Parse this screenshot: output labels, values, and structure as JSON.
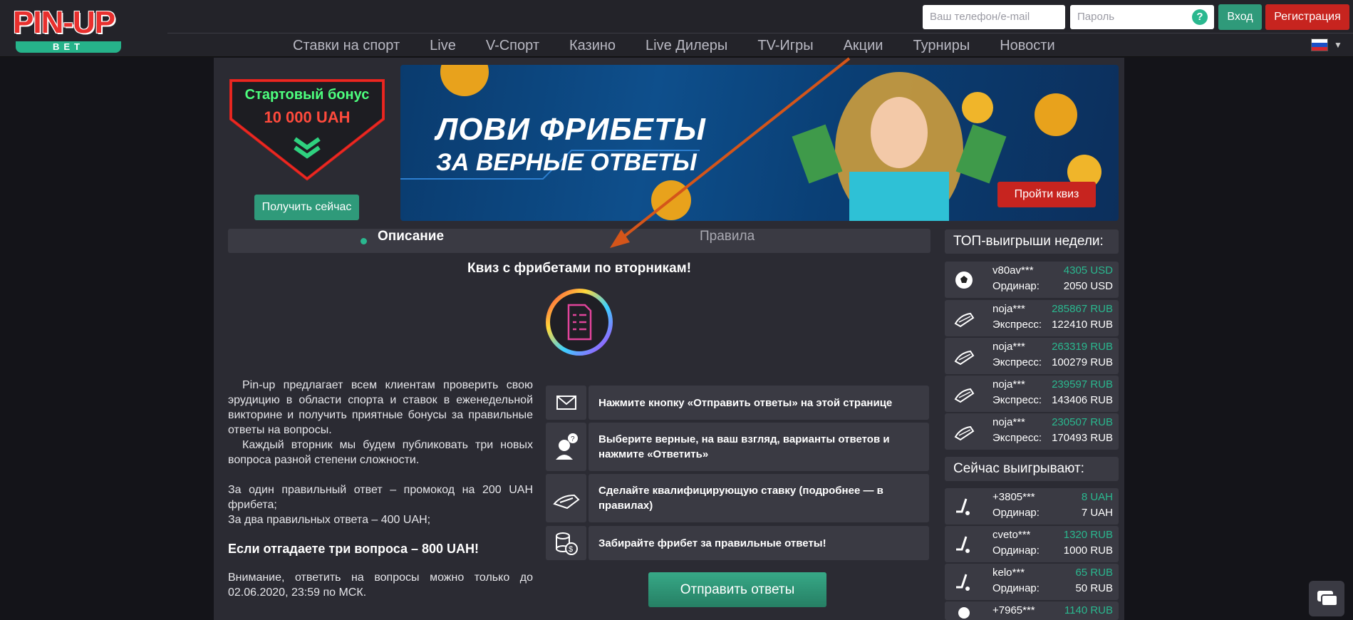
{
  "brand": {
    "logo": "PIN-UP",
    "sub": "BET"
  },
  "nav": [
    "Ставки на спорт",
    "Live",
    "V-Спорт",
    "Казино",
    "Live Дилеры",
    "TV-Игры",
    "Акции",
    "Турниры",
    "Новости"
  ],
  "auth": {
    "phone_placeholder": "Ваш телефон/e-mail",
    "password_placeholder": "Пароль",
    "help": "?",
    "login": "Вход",
    "register": "Регистрация"
  },
  "bonus": {
    "line1": "Стартовый бонус",
    "line2": "10 000 UAH",
    "button": "Получить сейчас"
  },
  "banner": {
    "title1": "ЛОВИ ФРИБЕТЫ",
    "title2": "ЗА ВЕРНЫЕ ОТВЕТЫ",
    "button": "Пройти квиз"
  },
  "tabs": {
    "active": "Описание",
    "other": "Правила"
  },
  "quiz": {
    "title": "Квиз с фрибетами по вторникам!",
    "p1": "Pin-up предлагает всем клиентам проверить свою эрудицию в области спорта и ставок в еженедельной викторине и получить приятные бонусы за правильные ответы на вопросы.",
    "p2": "Каждый вторник мы будем публиковать три новых вопроса разной степени сложности.",
    "p3": "За один правильный ответ – промокод на 200 UAH фрибета;",
    "p4": "За два правильных ответа – 400 UAH;",
    "big": "Если отгадаете три вопроса – 800 UAH!",
    "notice": "Внимание, ответить на вопросы можно только до 02.06.2020, 23:59 по МСК."
  },
  "steps": [
    {
      "icon": "envelope-icon",
      "text": "Нажмите кнопку «Отправить ответы» на этой странице"
    },
    {
      "icon": "question-person-icon",
      "text": "Выберите верные, на ваш взгляд, варианты ответов и нажмите «Ответить»"
    },
    {
      "icon": "bet-hand-icon",
      "text": "Сделайте квалифицирующую ставку (подробнее — в правилах)"
    },
    {
      "icon": "coins-icon",
      "text": "Забирайте фрибет за правильные ответы!"
    }
  ],
  "send_button": "Отправить ответы",
  "top_header": "ТОП-выигрыши недели:",
  "top": [
    {
      "icon": "soccer-ball-icon",
      "name": "v80av***",
      "amount": "4305 USD",
      "label": "Ординар:",
      "value": "2050 USD"
    },
    {
      "icon": "express-icon",
      "name": "noja***",
      "amount": "285867 RUB",
      "label": "Экспресс:",
      "value": "122410 RUB"
    },
    {
      "icon": "express-icon",
      "name": "noja***",
      "amount": "263319 RUB",
      "label": "Экспресс:",
      "value": "100279 RUB"
    },
    {
      "icon": "express-icon",
      "name": "noja***",
      "amount": "239597 RUB",
      "label": "Экспресс:",
      "value": "143406 RUB"
    },
    {
      "icon": "express-icon",
      "name": "noja***",
      "amount": "230507 RUB",
      "label": "Экспресс:",
      "value": "170493 RUB"
    }
  ],
  "now_header": "Сейчас выигрывают:",
  "now": [
    {
      "icon": "hockey-icon",
      "name": "+3805***",
      "amount": "8 UAH",
      "label": "Ординар:",
      "value": "7 UAH"
    },
    {
      "icon": "hockey-icon",
      "name": "cveto***",
      "amount": "1320 RUB",
      "label": "Ординар:",
      "value": "1000 RUB"
    },
    {
      "icon": "hockey-icon",
      "name": "kelo***",
      "amount": "65 RUB",
      "label": "Ординар:",
      "value": "50 RUB"
    },
    {
      "icon": "soccer-ball-icon",
      "name": "+7965***",
      "amount": "1140 RUB",
      "label": "",
      "value": ""
    }
  ],
  "colors": {
    "accent": "#2ab88f",
    "red": "#c7241f",
    "panel": "#3a3a43",
    "bg": "#2b2b33"
  }
}
